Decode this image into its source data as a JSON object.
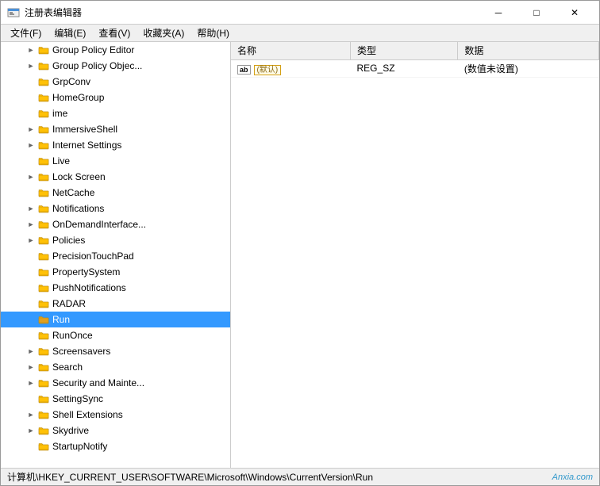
{
  "window": {
    "title": "注册表编辑器",
    "icon": "regedit"
  },
  "titlebar": {
    "minimize_label": "─",
    "maximize_label": "□",
    "close_label": "✕"
  },
  "menubar": {
    "items": [
      {
        "label": "文件(F)"
      },
      {
        "label": "编辑(E)"
      },
      {
        "label": "查看(V)"
      },
      {
        "label": "收藏夹(A)"
      },
      {
        "label": "帮助(H)"
      }
    ]
  },
  "tree": {
    "items": [
      {
        "label": "Group Policy Editor",
        "indent": 1,
        "has_arrow": true,
        "expanded": false
      },
      {
        "label": "Group Policy Objec...",
        "indent": 1,
        "has_arrow": true,
        "expanded": false
      },
      {
        "label": "GrpConv",
        "indent": 1,
        "has_arrow": false,
        "expanded": false
      },
      {
        "label": "HomeGroup",
        "indent": 1,
        "has_arrow": false,
        "expanded": false
      },
      {
        "label": "ime",
        "indent": 1,
        "has_arrow": false,
        "expanded": false
      },
      {
        "label": "ImmersiveShell",
        "indent": 1,
        "has_arrow": true,
        "expanded": false
      },
      {
        "label": "Internet Settings",
        "indent": 1,
        "has_arrow": true,
        "expanded": false
      },
      {
        "label": "Live",
        "indent": 1,
        "has_arrow": false,
        "expanded": false
      },
      {
        "label": "Lock Screen",
        "indent": 1,
        "has_arrow": true,
        "expanded": false
      },
      {
        "label": "NetCache",
        "indent": 1,
        "has_arrow": false,
        "expanded": false
      },
      {
        "label": "Notifications",
        "indent": 1,
        "has_arrow": true,
        "expanded": false
      },
      {
        "label": "OnDemandInterface...",
        "indent": 1,
        "has_arrow": true,
        "expanded": false
      },
      {
        "label": "Policies",
        "indent": 1,
        "has_arrow": true,
        "expanded": false
      },
      {
        "label": "PrecisionTouchPad",
        "indent": 1,
        "has_arrow": false,
        "expanded": false
      },
      {
        "label": "PropertySystem",
        "indent": 1,
        "has_arrow": false,
        "expanded": false
      },
      {
        "label": "PushNotifications",
        "indent": 1,
        "has_arrow": false,
        "expanded": false
      },
      {
        "label": "RADAR",
        "indent": 1,
        "has_arrow": false,
        "expanded": false
      },
      {
        "label": "Run",
        "indent": 1,
        "has_arrow": false,
        "expanded": false,
        "selected": true
      },
      {
        "label": "RunOnce",
        "indent": 1,
        "has_arrow": false,
        "expanded": false
      },
      {
        "label": "Screensavers",
        "indent": 1,
        "has_arrow": true,
        "expanded": false
      },
      {
        "label": "Search",
        "indent": 1,
        "has_arrow": true,
        "expanded": false
      },
      {
        "label": "Security and Mainte...",
        "indent": 1,
        "has_arrow": true,
        "expanded": false
      },
      {
        "label": "SettingSync",
        "indent": 1,
        "has_arrow": false,
        "expanded": false
      },
      {
        "label": "Shell Extensions",
        "indent": 1,
        "has_arrow": true,
        "expanded": false
      },
      {
        "label": "Skydrive",
        "indent": 1,
        "has_arrow": true,
        "expanded": false
      },
      {
        "label": "StartupNotify",
        "indent": 1,
        "has_arrow": false,
        "expanded": false
      }
    ]
  },
  "detail": {
    "columns": [
      {
        "label": "名称"
      },
      {
        "label": "类型"
      },
      {
        "label": "数据"
      }
    ],
    "rows": [
      {
        "name": "(默认)",
        "type": "REG_SZ",
        "data": "(数值未设置)",
        "icon_type": "ab",
        "is_default": true
      }
    ]
  },
  "statusbar": {
    "path": "计算机\\HKEY_CURRENT_USER\\SOFTWARE\\Microsoft\\Windows\\CurrentVersion\\Run",
    "watermark": "Anxia.com"
  }
}
